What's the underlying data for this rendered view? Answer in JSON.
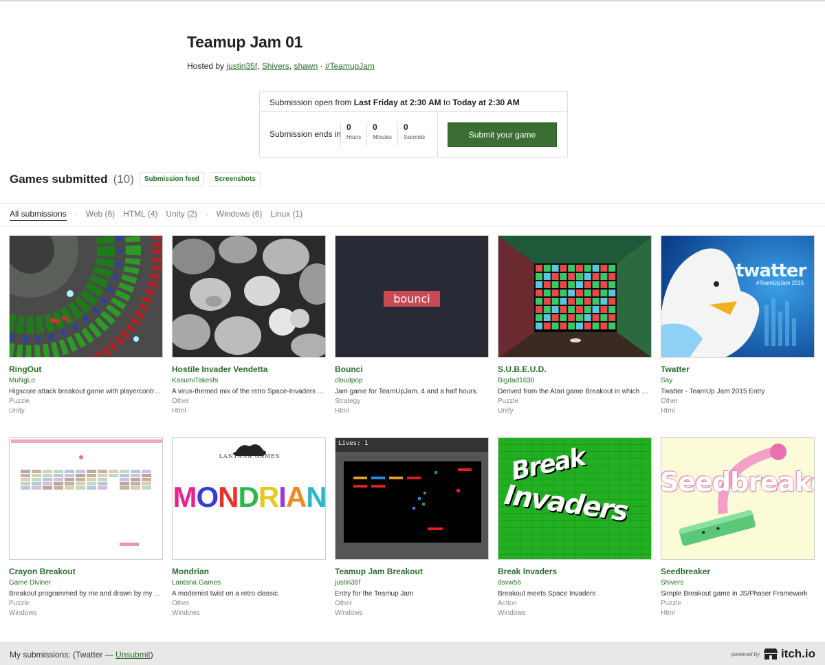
{
  "jam": {
    "title": "Teamup Jam 01",
    "hosted_prefix": "Hosted by ",
    "hosts": [
      "justin35f",
      "Shivers",
      "shawn"
    ],
    "hashtag": "#TeamupJam"
  },
  "submission": {
    "open_prefix": "Submission open from ",
    "open_from": "Last Friday at 2:30 AM",
    "open_to_word": " to ",
    "open_to": "Today at 2:30 AM",
    "ends_label": "Submission ends in",
    "countdown": [
      {
        "value": "0",
        "unit": "Hours"
      },
      {
        "value": "0",
        "unit": "Minutes"
      },
      {
        "value": "0",
        "unit": "Seconds"
      }
    ],
    "submit_button": "Submit your game"
  },
  "games_section": {
    "heading": "Games submitted",
    "count": "(10)",
    "feed_button": "Submission feed",
    "screenshots_button": "Screenshots"
  },
  "filters": {
    "all": "All submissions",
    "web": "Web (6)",
    "html": "HTML (4)",
    "unity": "Unity (2)",
    "windows": "Windows (6)",
    "linux": "Linux (1)",
    "separator": "·"
  },
  "games": [
    {
      "title": "RingOut",
      "author": "MuNgLo",
      "desc": "Higscore attack breakout game with playercontrol of the ball",
      "genre": "Puzzle",
      "platform": "Unity",
      "thumb": "ringout"
    },
    {
      "title": "Hostile Invader Vendetta",
      "author": "KasumiTakeshi",
      "desc": "A virus-themed mix of the retro Space-Invaders and Breakout",
      "genre": "Other",
      "platform": "Html",
      "thumb": "cells"
    },
    {
      "title": "Bounci",
      "author": "cloudpop",
      "desc": "Jam game for TeamUpJam. 4 and a half hours.",
      "genre": "Strategy",
      "platform": "Html",
      "thumb": "bounci"
    },
    {
      "title": "S.U.B.E.U.D.",
      "author": "Bigdad1630",
      "desc": "Derived from the Atari game Breakout in which you have to",
      "genre": "Puzzle",
      "platform": "Unity",
      "thumb": "subeud"
    },
    {
      "title": "Twatter",
      "author": "Say",
      "desc": "Twatter - TeamUp Jam 2015 Entry",
      "genre": "Other",
      "platform": "Html",
      "thumb": "twatter"
    },
    {
      "title": "Crayon Breakout",
      "author": "Game Diviner",
      "desc": "Breakout programmed by me and drawn by my son with crayons",
      "genre": "Puzzle",
      "platform": "Windows",
      "thumb": "crayon"
    },
    {
      "title": "Mondrian",
      "author": "Lantana Games",
      "desc": "A modernist twist on a retro classic.",
      "genre": "Other",
      "platform": "Windows",
      "thumb": "mondrian"
    },
    {
      "title": "Teamup Jam Breakout",
      "author": "justin35f",
      "desc": "Entry for the Teamup Jam",
      "genre": "Other",
      "platform": "Windows",
      "thumb": "tjbreakout"
    },
    {
      "title": "Break Invaders",
      "author": "dsvw56",
      "desc": "Breakout meets Space Invaders",
      "genre": "Action",
      "platform": "Windows",
      "thumb": "breakinvaders"
    },
    {
      "title": "Seedbreaker",
      "author": "Shivers",
      "desc": "Simple Breakout game in JS/Phaser Framework",
      "genre": "Puzzle",
      "platform": "Html",
      "thumb": "seedbreaker"
    }
  ],
  "thumb_text": {
    "bounci_logo": "bounci",
    "twatter_logo": "twatter",
    "twatter_tag": "#TeamUpJam 2015",
    "lantana": "LANTANA GAMES",
    "mondrian": "MONDRIAN",
    "lives": "Lives: 1",
    "break": "Break",
    "invaders": "Invaders",
    "seedbreaker": "Seedbreaker"
  },
  "footer": {
    "mine_prefix": "My submissions:  (Twatter — ",
    "unsubmit": "Unsubmit",
    "mine_suffix": ")",
    "powered_by": "powered by",
    "logo": "itch.io"
  },
  "colors": {
    "accent": "#2a6e2a",
    "submit_bg": "#3a6e32"
  }
}
